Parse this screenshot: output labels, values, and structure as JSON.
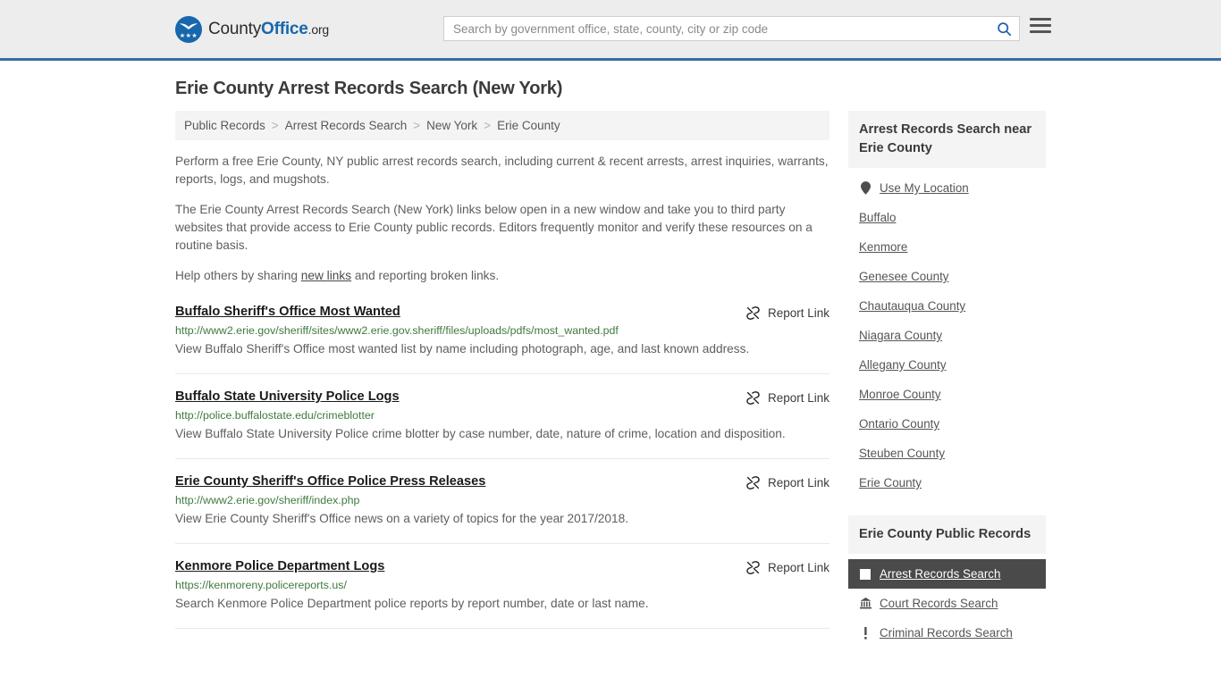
{
  "header": {
    "logo": {
      "part1": "County",
      "part2": "Office",
      "part3": ".org",
      "icon": "eagle-shield-logo"
    },
    "search": {
      "placeholder": "Search by government office, state, county, city or zip code",
      "value": "",
      "search_icon": "search-icon"
    },
    "menu_icon": "hamburger-menu-icon"
  },
  "page_title": "Erie County Arrest Records Search (New York)",
  "breadcrumb": [
    {
      "label": "Public Records"
    },
    {
      "label": "Arrest Records Search"
    },
    {
      "label": "New York"
    },
    {
      "label": "Erie County"
    }
  ],
  "breadcrumb_separator": ">",
  "intro": {
    "p1": "Perform a free Erie County, NY public arrest records search, including current & recent arrests, arrest inquiries, warrants, reports, logs, and mugshots.",
    "p2": "The Erie County Arrest Records Search (New York) links below open in a new window and take you to third party websites that provide access to Erie County public records. Editors frequently monitor and verify these resources on a routine basis.",
    "p3_before": "Help others by sharing ",
    "p3_link": "new links",
    "p3_after": " and reporting broken links."
  },
  "report_link_label": "Report Link",
  "report_link_icon": "unlink-icon",
  "results": [
    {
      "title": "Buffalo Sheriff's Office Most Wanted",
      "url": "http://www2.erie.gov/sheriff/sites/www2.erie.gov.sheriff/files/uploads/pdfs/most_wanted.pdf",
      "description": "View Buffalo Sheriff's Office most wanted list by name including photograph, age, and last known address."
    },
    {
      "title": "Buffalo State University Police Logs",
      "url": "http://police.buffalostate.edu/crimeblotter",
      "description": "View Buffalo State University Police crime blotter by case number, date, nature of crime, location and disposition."
    },
    {
      "title": "Erie County Sheriff's Office Police Press Releases",
      "url": "http://www2.erie.gov/sheriff/index.php",
      "description": "View Erie County Sheriff's Office news on a variety of topics for the year 2017/2018."
    },
    {
      "title": "Kenmore Police Department Logs",
      "url": "https://kenmoreny.policereports.us/",
      "description": "Search Kenmore Police Department police reports by report number, date or last name."
    }
  ],
  "sidebar": {
    "nearby": {
      "heading": "Arrest Records Search near Erie County",
      "items": [
        {
          "label": "Use My Location",
          "icon": "map-pin-icon"
        },
        {
          "label": "Buffalo",
          "icon": ""
        },
        {
          "label": "Kenmore",
          "icon": ""
        },
        {
          "label": "Genesee County",
          "icon": ""
        },
        {
          "label": "Chautauqua County",
          "icon": ""
        },
        {
          "label": "Niagara County",
          "icon": ""
        },
        {
          "label": "Allegany County",
          "icon": ""
        },
        {
          "label": "Monroe County",
          "icon": ""
        },
        {
          "label": "Ontario County",
          "icon": ""
        },
        {
          "label": "Steuben County",
          "icon": ""
        },
        {
          "label": "Erie County",
          "icon": ""
        }
      ]
    },
    "public_records": {
      "heading": "Erie County Public Records",
      "items": [
        {
          "label": "Arrest Records Search",
          "icon": "handcuffs-icon",
          "active": true
        },
        {
          "label": "Court Records Search",
          "icon": "courthouse-icon",
          "active": false
        },
        {
          "label": "Criminal Records Search",
          "icon": "exclamation-icon",
          "active": false
        }
      ]
    }
  },
  "colors": {
    "header_bg": "#ededed",
    "header_border": "#3a6ea5",
    "logo_blue": "#1767ad",
    "url_green": "#3f7a3f",
    "active_bg": "#4a4a4a",
    "panel_bg": "#f4f4f4"
  }
}
